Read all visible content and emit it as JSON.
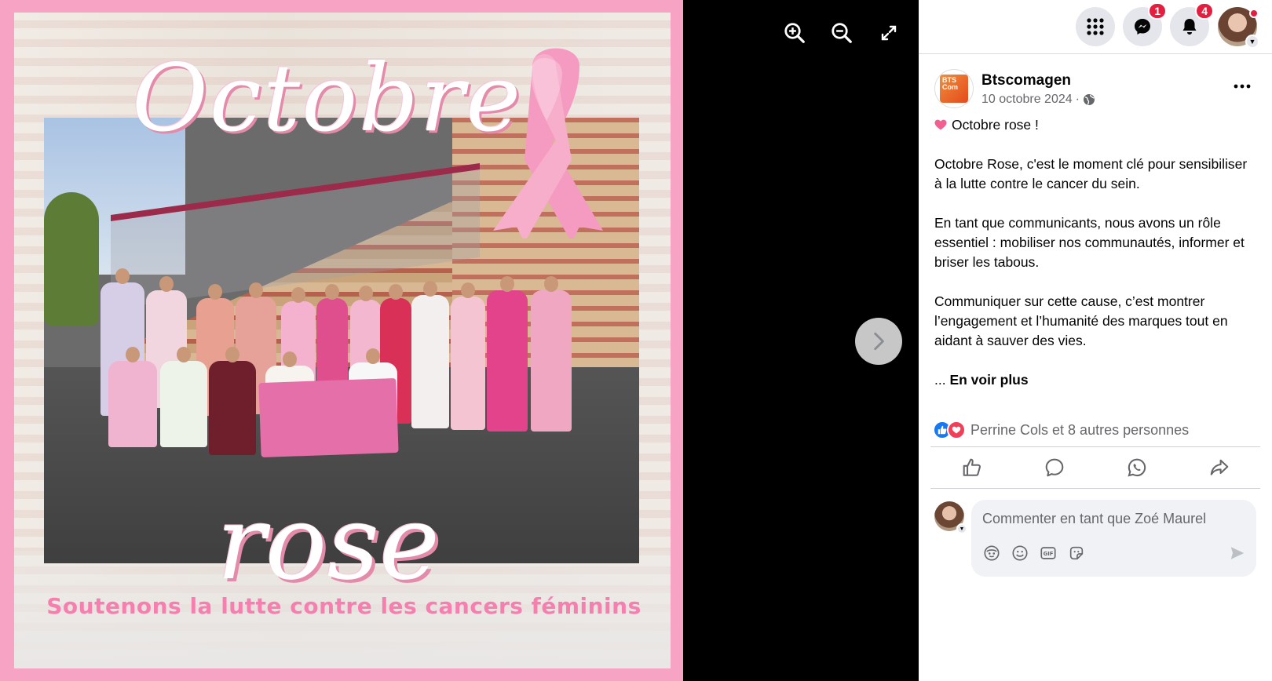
{
  "poster": {
    "title_line1": "Octobre",
    "title_line2": "rose",
    "subtitle": "Soutenons la lutte contre les cancers féminins"
  },
  "viewer": {
    "controls": [
      "zoom-in-icon",
      "zoom-out-icon",
      "fullscreen-icon",
      "chevron-right-icon"
    ]
  },
  "topbar": {
    "messenger_badge": "1",
    "notifications_badge": "4"
  },
  "post": {
    "page_name": "Btscomagen",
    "page_logo_text": "BTS Com",
    "date": "10 octobre 2024",
    "separator": "·",
    "paragraphs": [
      "Octobre rose !",
      "Octobre Rose, c'est le moment clé pour sensibiliser à la lutte contre le cancer du sein.",
      "En tant que communicants, nous avons un rôle essentiel : mobiliser nos communautés, informer et briser les tabous.",
      "Communiquer sur cette cause, c’est montrer l’engagement et l’humanité des marques tout en aidant à sauver des vies."
    ],
    "ellipsis": "... ",
    "see_more": "En voir plus",
    "reaction_summary": "Perrine Cols et 8 autres personnes"
  },
  "actions": [
    "like-icon",
    "comment-icon",
    "whatsapp-icon",
    "share-icon"
  ],
  "comment": {
    "placeholder": "Commenter en tant que Zoé Maurel",
    "tools": [
      "avatar-sticker-icon",
      "emoji-icon",
      "gif-icon",
      "sticker-icon"
    ]
  },
  "colors": {
    "accent_blue": "#1877f2",
    "badge_red": "#e41e3f",
    "poster_pink": "#f7a3c4"
  }
}
